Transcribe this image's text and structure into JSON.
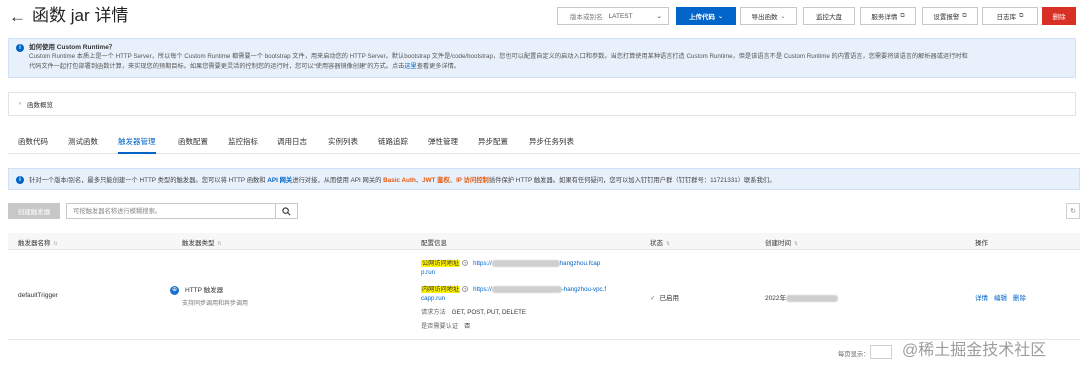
{
  "header": {
    "back_icon": "arrow-left-icon",
    "title": "函数 jar 详情",
    "version_label": "版本或别名",
    "version_value": "LATEST",
    "upload_code": "上传代码",
    "export_function": "导出函数",
    "monitor_dashboard": "监控大盘",
    "service_details": "服务详情",
    "settings_alert": "设置报警",
    "log_library": "日志库",
    "delete": "删除"
  },
  "runtime_banner": {
    "title": "如何使用 Custom Runtime？",
    "line1": "Custom Runtime 本质上是一个 HTTP Server，所以每个 Custom Runtime 都需要一个 bootstrap 文件，用来启动您的 HTTP Server。默认bootstrap 文件是/code/bootstrap，您也可以配置自定义的启动入口和参数。当您打算使用某种语言打造 Custom Runtime，但是该语言不是 Custom Runtime 的内置语言，您需要将该语言的解析器或运行时和",
    "line2": "代码文件一起打包部署到函数计算，来实现您的预期目标。如果您需要更灵活的控制您的运行时，您可以“使用容器镜像创建”的方式。点击",
    "link": "这里",
    "line2_end": "查看更多详情。"
  },
  "overview": {
    "label": "函数概览"
  },
  "tabs": [
    {
      "label": "函数代码"
    },
    {
      "label": "测试函数"
    },
    {
      "label": "触发器管理"
    },
    {
      "label": "函数配置"
    },
    {
      "label": "监控指标"
    },
    {
      "label": "调用日志"
    },
    {
      "label": "实例列表"
    },
    {
      "label": "链路追踪"
    },
    {
      "label": "弹性管理"
    },
    {
      "label": "异步配置"
    },
    {
      "label": "异步任务列表"
    }
  ],
  "active_tab": "触发器管理",
  "trigger_banner": {
    "p1": "针对一个版本/别名，最多只能创建一个 HTTP 类型的触发器。您可以将 HTTP 函数和",
    "api": "API 网关",
    "p2": "进行对接，从而使用 API 网关的",
    "basic": "Basic Auth",
    "jwt": "JWT 鉴权",
    "ip": "IP 访问控制",
    "p3": "插件保护 HTTP 触发器。如果有任何疑问，您可以加入钉钉用户群（钉钉群号：11721331）联系我们。"
  },
  "toolbar": {
    "create_button": "创建触发器",
    "search_placeholder": "可按触发器名称进行模糊搜索。"
  },
  "table": {
    "columns": [
      "触发器名称",
      "触发器类型",
      "配置信息",
      "状态",
      "创建时间",
      "操作"
    ],
    "rows": [
      {
        "name": "defaultTrigger",
        "type": "HTTP 触发器",
        "type_sub": "支持同步调用和异步调用",
        "public_label": "公网访问地址",
        "public_url_prefix": "https://",
        "public_url_suffix": "hangzhou.fcap",
        "public_url_tail": "p.run",
        "internal_label": "内网访问地址",
        "internal_url_prefix": "https://",
        "internal_url_suffix": "-hangzhou-vpc.f",
        "internal_url_tail": "capp.run",
        "method_key": "请求方法",
        "method_value": "GET, POST, PUT, DELETE",
        "auth_key": "是否需要认证",
        "auth_value": "否",
        "status": "已启用",
        "created_prefix": "2022年",
        "actions": [
          "详情",
          "编辑",
          "删除"
        ]
      }
    ]
  },
  "pager": {
    "label": "每页显示："
  },
  "watermark": "@稀土掘金技术社区"
}
